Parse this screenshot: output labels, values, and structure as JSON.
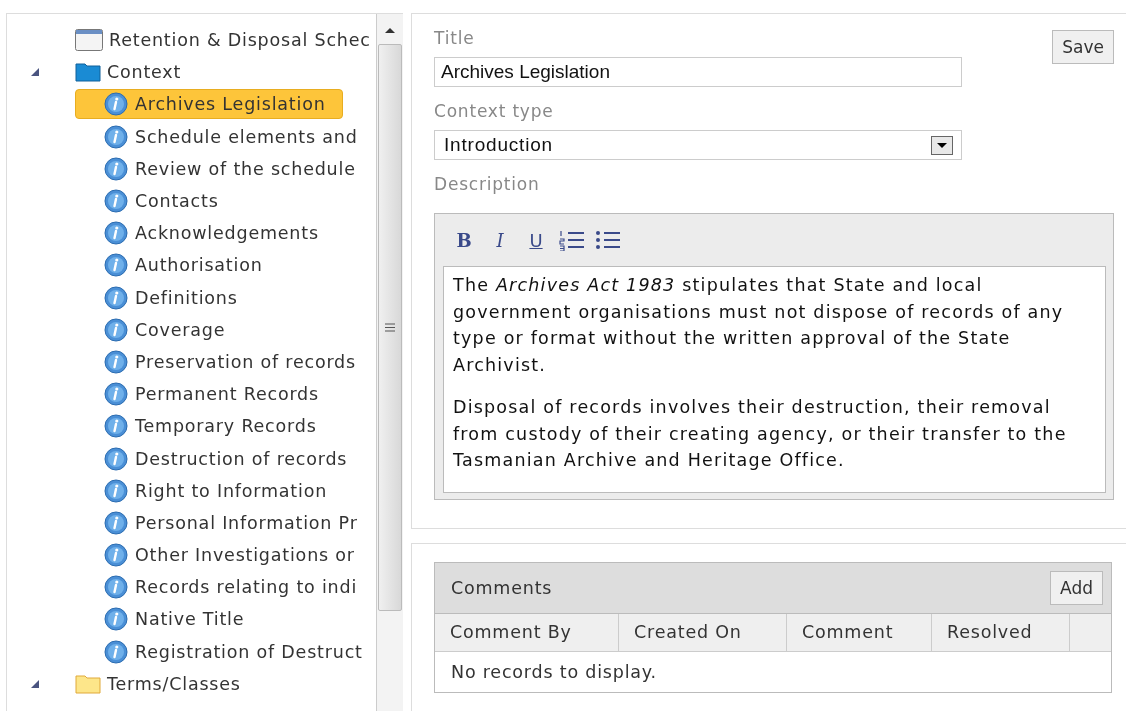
{
  "tree": {
    "items": [
      {
        "label": "Retention & Disposal Schec",
        "kind": "page"
      },
      {
        "label": "Context",
        "kind": "context",
        "expanded": true,
        "children": [
          {
            "label": "Archives Legislation",
            "kind": "info",
            "selected": true
          },
          {
            "label": "Schedule elements and",
            "kind": "info",
            "selected": false
          },
          {
            "label": "Review of the schedule",
            "kind": "info",
            "selected": false
          },
          {
            "label": "Contacts",
            "kind": "info",
            "selected": false
          },
          {
            "label": "Acknowledgements",
            "kind": "info",
            "selected": false
          },
          {
            "label": "Authorisation",
            "kind": "info",
            "selected": false
          },
          {
            "label": "Definitions",
            "kind": "info",
            "selected": false
          },
          {
            "label": "Coverage",
            "kind": "info",
            "selected": false
          },
          {
            "label": "Preservation of records",
            "kind": "info",
            "selected": false
          },
          {
            "label": "Permanent Records",
            "kind": "info",
            "selected": false
          },
          {
            "label": "Temporary Records",
            "kind": "info",
            "selected": false
          },
          {
            "label": "Destruction of records",
            "kind": "info",
            "selected": false
          },
          {
            "label": "Right to Information",
            "kind": "info",
            "selected": false
          },
          {
            "label": "Personal Information Pr",
            "kind": "info",
            "selected": false
          },
          {
            "label": "Other Investigations or",
            "kind": "info",
            "selected": false
          },
          {
            "label": "Records relating to indi",
            "kind": "info",
            "selected": false
          },
          {
            "label": "Native Title",
            "kind": "info",
            "selected": false
          },
          {
            "label": "Registration of Destruct",
            "kind": "info",
            "selected": false
          }
        ]
      },
      {
        "label": "Terms/Classes",
        "kind": "terms",
        "expanded": true
      }
    ]
  },
  "form": {
    "title_label": "Title",
    "save": "Save",
    "title_value": "Archives Legislation",
    "type_label": "Context type",
    "type_value": "Introduction",
    "description_label": "Description",
    "toolbar": [
      "B",
      "I",
      "U"
    ],
    "paragraphs": [
      "The *Archives Act 1983* stipulates that State and local government organisations must not dispose of records of any type or format without the written approval of the State Archivist.",
      "Disposal of records involves their destruction, their removal from custody of their creating agency, or their transfer to the Tasmanian Archive and Heritage Office."
    ]
  },
  "comments": {
    "title": "Comments",
    "add": "Add",
    "columns": [
      "Comment By",
      "Created On",
      "Comment",
      "Resolved"
    ],
    "empty": "No records to display."
  }
}
